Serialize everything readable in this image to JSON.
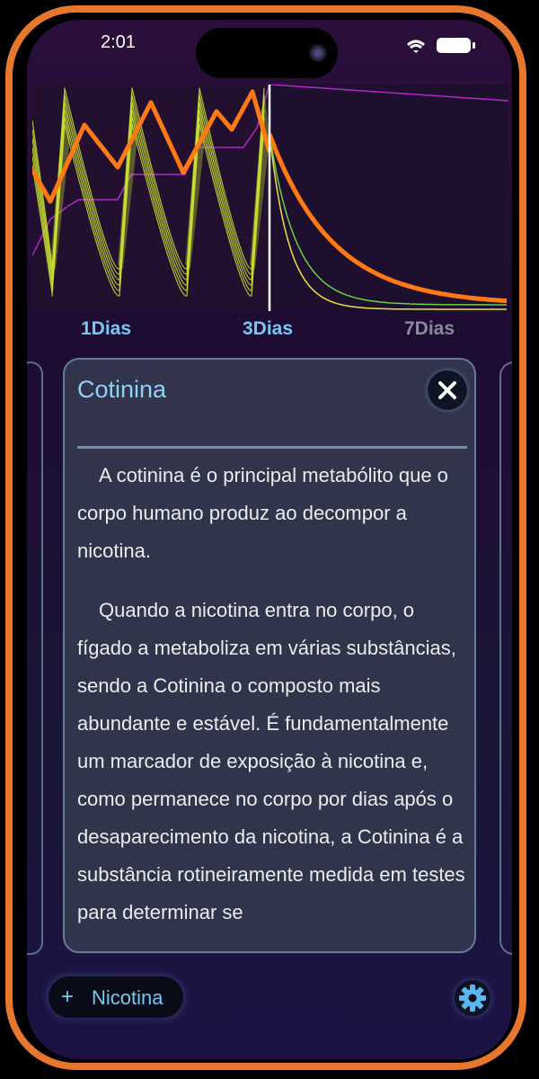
{
  "status_bar": {
    "time": "2:01"
  },
  "chart_data": {
    "type": "line",
    "x_range": [
      0,
      7
    ],
    "current_day": 3,
    "timeline_labels": [
      "1Dias",
      "3Dias",
      "7Dias"
    ],
    "series": [
      {
        "color": "#ff7a14",
        "values_desc": "cotinina sawtooth days 0-3, exponential decay after day 3"
      },
      {
        "color": "#c8e030",
        "values_desc": "nicotina spikes days 0-3"
      },
      {
        "color": "#b028c8"
      }
    ]
  },
  "card": {
    "title": "Cotinina",
    "paragraphs": [
      "A cotinina é o principal metabólito que o corpo humano produz ao decompor a nicotina.",
      "Quando a nicotina entra no corpo, o fígado a metaboliza em várias substâncias, sendo a Cotinina o composto mais abundante e estável. É fundamentalmente um marcador de exposição à nicotina e, como permanece no corpo por dias após o desaparecimento da nicotina, a Cotinina é a substância rotineiramente medida em testes para determinar se"
    ],
    "close_icon": "close-icon"
  },
  "bottom_bar": {
    "add_symbol": "+",
    "add_label": "Nicotina",
    "settings_icon": "gear-icon"
  },
  "colors": {
    "accent": "#77c8f2",
    "frame": "#e8772e",
    "inactive_label": "#8a8a9a"
  }
}
